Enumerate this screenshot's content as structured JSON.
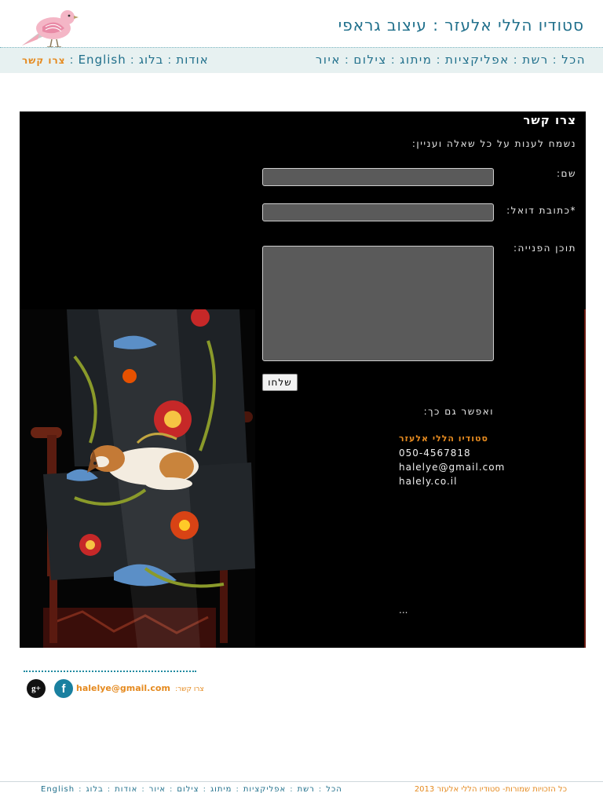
{
  "header": {
    "site_title": "סטודיו הללי אלעזר : עיצוב גראפי"
  },
  "nav": {
    "main_items": [
      "הכל",
      "רשת",
      "אפליקציות",
      "מיתוג",
      "צילום",
      "איור"
    ],
    "secondary_items": [
      "אודות",
      "בלוג",
      "English"
    ],
    "active_item": "צרו קשר"
  },
  "form": {
    "title": "צרו קשר",
    "intro": "נשמח לענות על כל שאלה ועניין:",
    "name_label": "שם:",
    "email_label": "*כתובת דואל:",
    "message_label": "תוכן הפנייה:",
    "name_value": "",
    "email_value": "",
    "message_value": "",
    "send_label": "שלחו"
  },
  "contact": {
    "also_title": "ואפשר גם כך:",
    "studio_name": "סטודיו הללי אלעזר",
    "phone": "050-4567818",
    "email": "halelye@gmail.com",
    "website": "halely.co.il",
    "ellipsis": "..."
  },
  "social": {
    "contact_label": "צרו קשר:",
    "contact_email": "halelye@gmail.com",
    "gplus_glyph": "g+",
    "facebook_glyph": "f"
  },
  "footer": {
    "copyright": "כל הזכויות שמורות- סטודיו הללי אלעזר 2013",
    "items": [
      "הכל",
      "רשת",
      "אפליקציות",
      "מיתוג",
      "צילום",
      "איור",
      "אודות",
      "בלוג",
      "English"
    ]
  },
  "colors": {
    "brand_teal": "#1f6f8b",
    "accent_orange": "#e58a1f",
    "nav_background": "#e7f1f1",
    "panel_background": "#000000"
  }
}
